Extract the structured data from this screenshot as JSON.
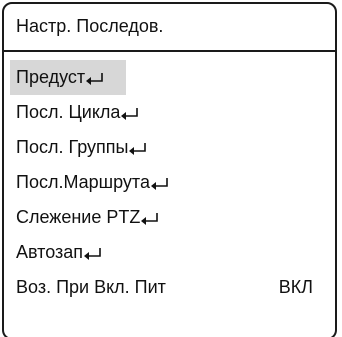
{
  "header": {
    "title": "Настр. Последов."
  },
  "menu": {
    "items": [
      {
        "label": "Предуст",
        "icon": "enter-icon"
      },
      {
        "label": "Посл. Цикла",
        "icon": "enter-icon"
      },
      {
        "label": "Посл. Группы",
        "icon": "enter-icon"
      },
      {
        "label": "Посл.Маршрута",
        "icon": "enter-icon"
      },
      {
        "label": "Слежение PTZ",
        "icon": "enter-icon"
      },
      {
        "label": "Автозап",
        "icon": "enter-icon"
      },
      {
        "label": "Воз. При Вкл. Пит",
        "value": "ВКЛ"
      }
    ],
    "selected_index": 0,
    "highlight_color": "#d7d7d7"
  }
}
